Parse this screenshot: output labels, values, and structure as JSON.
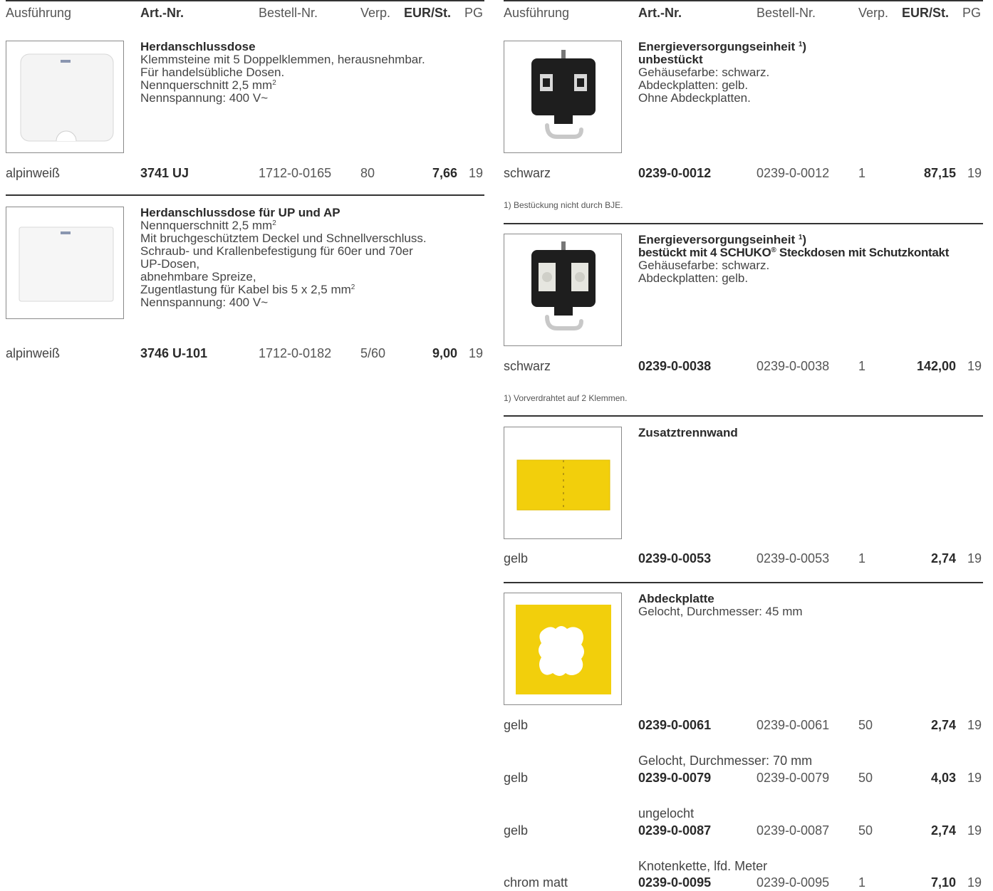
{
  "header": {
    "ausfuehrung": "Ausführung",
    "art_nr": "Art.-Nr.",
    "bestell_nr": "Bestell-Nr.",
    "verp": "Verp.",
    "eur_st": "EUR/St.",
    "pg": "PG"
  },
  "left": {
    "p1": {
      "title": "Herdanschlussdose",
      "lines": [
        "Klemmsteine mit 5 Doppelklemmen, herausnehmbar.",
        "Für handelsübliche Dosen.",
        "Nennquerschnitt 2,5 mm",
        "Nennspannung: 400 V~"
      ],
      "sup": "2",
      "row": {
        "ausf": "alpinweiß",
        "art": "3741 UJ",
        "best": "1712-0-0165",
        "verp": "80",
        "price": "7,66",
        "pg": "19"
      }
    },
    "p2": {
      "title": "Herdanschlussdose für UP und AP",
      "lines": [
        "Nennquerschnitt 2,5 mm",
        "Mit bruchgeschütztem Deckel und Schnellverschluss.",
        "Schraub- und Krallenbefestigung für 60er und 70er",
        "UP-Dosen,",
        "abnehmbare Spreize,",
        "Zugentlastung für Kabel bis 5 x 2,5 mm",
        "Nennspannung: 400 V~"
      ],
      "sup": "2",
      "row": {
        "ausf": "alpinweiß",
        "art": "3746 U-101",
        "best": "1712-0-0182",
        "verp": "5/60",
        "price": "9,00",
        "pg": "19"
      }
    }
  },
  "right": {
    "p1": {
      "title": "Energieversorgungseinheit",
      "title_sup": "1",
      "title2": "unbestückt",
      "lines": [
        "Gehäusefarbe: schwarz.",
        "Abdeckplatten: gelb.",
        "Ohne Abdeckplatten."
      ],
      "row": {
        "ausf": "schwarz",
        "art": "0239-0-0012",
        "best": "0239-0-0012",
        "verp": "1",
        "price": "87,15",
        "pg": "19"
      },
      "note": "1)  Bestückung nicht durch BJE."
    },
    "p2": {
      "title": "Energieversorgungseinheit",
      "title_sup": "1",
      "title2": "bestückt mit 4 SCHUKO",
      "reg": "®",
      "title2b": " Steckdosen mit Schutzkontakt",
      "lines": [
        "Gehäusefarbe: schwarz.",
        "Abdeckplatten: gelb."
      ],
      "row": {
        "ausf": "schwarz",
        "art": "0239-0-0038",
        "best": "0239-0-0038",
        "verp": "1",
        "price": "142,00",
        "pg": "19"
      },
      "note": "1)  Vorverdrahtet auf 2 Klemmen."
    },
    "p3": {
      "title": "Zusatztrennwand",
      "row": {
        "ausf": "gelb",
        "art": "0239-0-0053",
        "best": "0239-0-0053",
        "verp": "1",
        "price": "2,74",
        "pg": "19"
      }
    },
    "p4": {
      "title": "Abdeckplatte",
      "line1": "Gelocht, Durchmesser: 45 mm",
      "row1": {
        "ausf": "gelb",
        "art": "0239-0-0061",
        "best": "0239-0-0061",
        "verp": "50",
        "price": "2,74",
        "pg": "19"
      },
      "sub2": "Gelocht, Durchmesser: 70 mm",
      "row2": {
        "ausf": "gelb",
        "art": "0239-0-0079",
        "best": "0239-0-0079",
        "verp": "50",
        "price": "4,03",
        "pg": "19"
      },
      "sub3": "ungelocht",
      "row3": {
        "ausf": "gelb",
        "art": "0239-0-0087",
        "best": "0239-0-0087",
        "verp": "50",
        "price": "2,74",
        "pg": "19"
      },
      "sub4": "Knotenkette, lfd. Meter",
      "row4": {
        "ausf": "chrom matt",
        "art": "0239-0-0095",
        "best": "0239-0-0095",
        "verp": "1",
        "price": "7,10",
        "pg": "19"
      }
    }
  },
  "colors": {
    "yellow": "#f2cf0c",
    "black": "#1e1e1e",
    "rule": "#333333"
  }
}
